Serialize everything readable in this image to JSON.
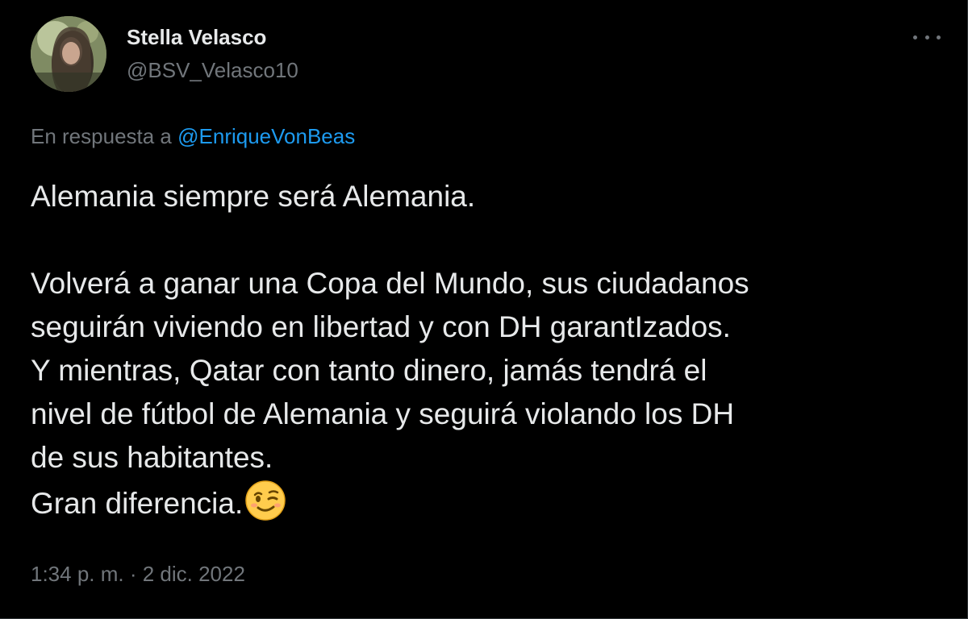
{
  "author": {
    "name": "Stella Velasco",
    "handle": "@BSV_Velasco10"
  },
  "reply": {
    "prefix": "En respuesta a",
    "mention": "@EnriqueVonBeas"
  },
  "tweet": {
    "lines": [
      "Alemania siempre será Alemania.",
      "",
      "Volverá a ganar una Copa del Mundo, sus ciudadanos",
      "seguirán viviendo en libertad y con DH garantIzados.",
      "Y mientras, Qatar con tanto dinero, jamás tendrá el",
      "nivel de fútbol de Alemania y seguirá violando los DH",
      "de sus habitantes.",
      "Gran diferencia."
    ],
    "emoji": "winking-face-emoji"
  },
  "meta": {
    "timestamp": "1:34 p. m. · 2 dic. 2022"
  },
  "icons": {
    "more": "more-options-icon",
    "avatar": "profile-photo"
  },
  "colors": {
    "background": "#000000",
    "text": "#e7e9ea",
    "secondary": "#71767b",
    "link": "#1d9bf0"
  }
}
